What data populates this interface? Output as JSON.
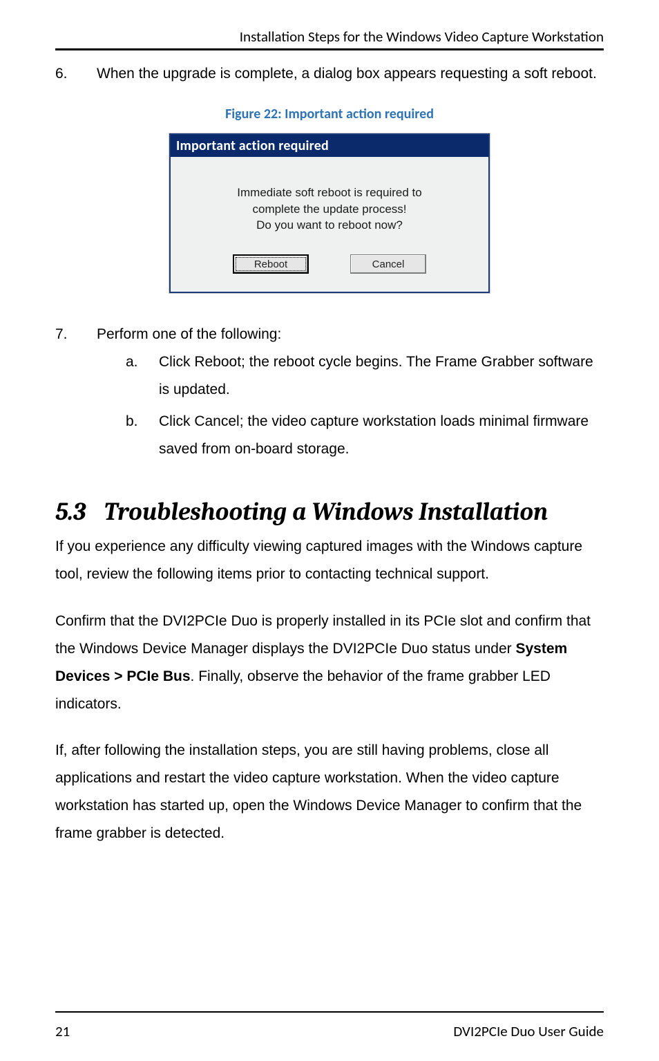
{
  "header": {
    "running_title": "Installation Steps for the Windows Video Capture Workstation"
  },
  "steps": {
    "six_marker": "6.",
    "six_text": "When the upgrade is complete, a dialog box appears requesting a soft reboot.",
    "seven_marker": "7.",
    "seven_text": "Perform one of the following:",
    "seven_a_marker": "a.",
    "seven_a_text": "Click Reboot; the reboot cycle begins. The Frame Grabber software is updated.",
    "seven_b_marker": "b.",
    "seven_b_text": "Click Cancel; the video capture workstation loads minimal firmware saved from on-board storage."
  },
  "figure": {
    "caption": "Figure 22: Important action required"
  },
  "dialog": {
    "title": "Important action required",
    "line1": "Immediate soft reboot is required to",
    "line2": "complete the update process!",
    "line3": "Do you want to reboot now?",
    "reboot_label": "Reboot",
    "cancel_label": "Cancel"
  },
  "section": {
    "number": "5.3",
    "title": "Troubleshooting a Windows Installation",
    "p1": "If you experience any difficulty viewing captured images with the Windows capture tool, review the following items prior to contacting technical support.",
    "p2_a": "Confirm that the DVI2PCIe Duo is properly installed in its PCIe slot and confirm that the Windows Device Manager displays the DVI2PCIe Duo status under ",
    "p2_bold": "System Devices > PCIe Bus",
    "p2_b": ". Finally, observe the behavior of the frame grabber LED indicators.",
    "p3": "If, after following the installation steps, you are still having problems, close all applications and restart the video capture workstation. When the video capture workstation has started up, open the Windows Device Manager to confirm that the frame grabber is detected."
  },
  "footer": {
    "page_number": "21",
    "guide_title": "DVI2PCIe Duo User Guide"
  }
}
